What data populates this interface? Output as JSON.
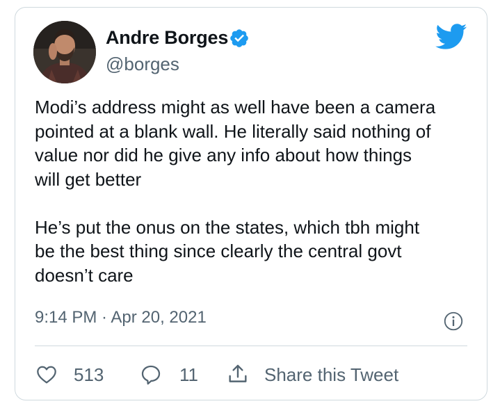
{
  "author": {
    "name": "Andre Borges",
    "handle": "@borges",
    "verified": true,
    "avatar_icon": "profile-photo"
  },
  "tweet": {
    "text": "Modi’s address might as well have been a camera\npointed at a blank wall. He literally said nothing of\nvalue nor did he give any info about how things\nwill get better\n\nHe’s put the onus on the states, which tbh might\nbe the best thing since clearly the central govt\ndoesn’t care",
    "timestamp": "9:14 PM · Apr 20, 2021"
  },
  "actions": {
    "likes": "513",
    "replies": "11",
    "share_label": "Share this Tweet"
  },
  "colors": {
    "brand": "#1d9bf0",
    "text": "#0f1419",
    "secondary": "#536471",
    "border": "#cfd9de"
  }
}
